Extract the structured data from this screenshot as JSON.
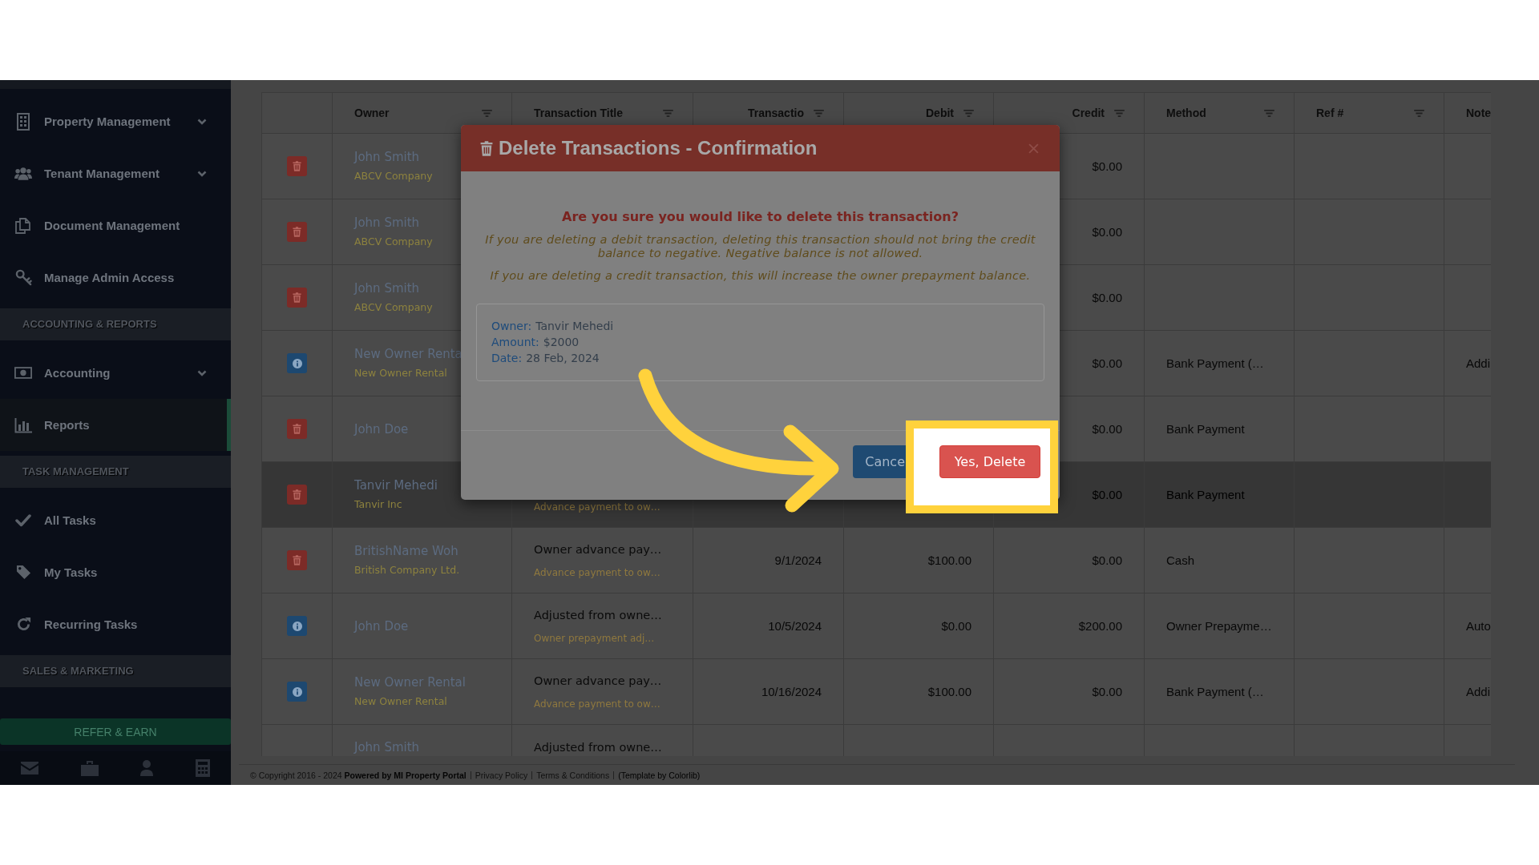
{
  "sidebar": {
    "items": [
      {
        "kind": "link",
        "label": "Property Management",
        "submenu": true,
        "selected": false
      },
      {
        "kind": "link",
        "label": "Tenant Management",
        "submenu": true,
        "selected": false
      },
      {
        "kind": "link",
        "label": "Document Management",
        "submenu": false,
        "selected": false
      },
      {
        "kind": "link",
        "label": "Manage Admin Access",
        "submenu": false,
        "selected": false
      },
      {
        "kind": "header",
        "label": "ACCOUNTING & REPORTS"
      },
      {
        "kind": "link",
        "label": "Accounting",
        "submenu": true,
        "selected": false
      },
      {
        "kind": "link",
        "label": "Reports",
        "submenu": false,
        "selected": true
      },
      {
        "kind": "header",
        "label": "TASK MANAGEMENT"
      },
      {
        "kind": "link",
        "label": "All Tasks",
        "submenu": false,
        "selected": false
      },
      {
        "kind": "link",
        "label": "My Tasks",
        "submenu": false,
        "selected": false
      },
      {
        "kind": "link",
        "label": "Recurring Tasks",
        "submenu": false,
        "selected": false
      },
      {
        "kind": "header",
        "label": "SALES & MARKETING"
      }
    ],
    "refer_button": "REFER & EARN"
  },
  "table": {
    "columns": [
      {
        "label": "Owner",
        "kind": "text",
        "filter": true
      },
      {
        "label": "Transaction Title",
        "kind": "text",
        "filter": true
      },
      {
        "label": "Transactio",
        "kind": "number",
        "filter": true
      },
      {
        "label": "Debit",
        "kind": "number",
        "filter": true
      },
      {
        "label": "Credit",
        "kind": "number",
        "filter": true
      },
      {
        "label": "Method",
        "kind": "text",
        "filter": true
      },
      {
        "label": "Ref #",
        "kind": "text",
        "filter": true
      },
      {
        "label": "Note",
        "kind": "text",
        "filter": false
      }
    ],
    "rows": [
      {
        "kind": "delete",
        "selected": false,
        "owner": "John Smith",
        "company": "ABCV Company",
        "credit": "$0.00"
      },
      {
        "kind": "delete",
        "selected": false,
        "owner": "John Smith",
        "company": "ABCV Company",
        "credit": "$0.00"
      },
      {
        "kind": "delete",
        "selected": false,
        "owner": "John Smith",
        "company": "ABCV Company",
        "credit": "$0.00"
      },
      {
        "kind": "info",
        "selected": false,
        "owner": "New Owner Renta",
        "company": "New Owner Rental",
        "credit": "$0.00",
        "method": "Bank Payment (…",
        "note": "Addi"
      },
      {
        "kind": "delete",
        "selected": false,
        "owner": "John Doe",
        "credit": "$0.00",
        "method": "Bank Payment"
      },
      {
        "kind": "delete",
        "selected": true,
        "owner": "Tanvir Mehedi",
        "company": "Tanvir Inc",
        "title_sub": "Advance payment to ow…",
        "credit": "$0.00",
        "method": "Bank Payment"
      },
      {
        "kind": "delete",
        "selected": false,
        "owner": "BritishName Woh",
        "company": "British Company Ltd.",
        "title": "Owner advance pay…",
        "title_sub": "Advance payment to ow…",
        "date": "9/1/2024",
        "debit": "$100.00",
        "credit": "$0.00",
        "method": "Cash"
      },
      {
        "kind": "info",
        "selected": false,
        "owner": "John Doe",
        "title": "Adjusted from owne…",
        "title_sub": "Owner prepayment adj…",
        "date": "10/5/2024",
        "debit": "$0.00",
        "credit": "$200.00",
        "method": "Owner Prepayme…",
        "note": "Auto"
      },
      {
        "kind": "info",
        "selected": false,
        "owner": "New Owner Rental",
        "company": "New Owner Rental",
        "title": "Owner advance pay…",
        "title_sub": "Advance payment to ow…",
        "date": "10/16/2024",
        "debit": "$100.00",
        "credit": "$0.00",
        "method": "Bank Payment (…",
        "note": "Addi"
      },
      {
        "selected": false,
        "owner": "John Smith",
        "title": "Adjusted from owne…"
      }
    ]
  },
  "footer": {
    "copyright": "© Copyright 2016 - 2024 **Powered by MI Property Portal**",
    "links": [
      "Privacy Policy",
      "Terms & Conditions"
    ],
    "credit": "(Template by Colorlib)"
  },
  "modal": {
    "title": "Delete Transactions - Confirmation",
    "question": "Are you sure you would like to delete this transaction?",
    "warnings": [
      "If you are deleting a debit transaction, deleting this transaction should not bring the credit balance to negative. Negative balance is not allowed.",
      "If you are deleting a credit transaction, this will increase the owner prepayment balance."
    ],
    "details": [
      {
        "label": "Owner:",
        "value": "Tanvir Mehedi"
      },
      {
        "label": "Amount:",
        "value": "$2000"
      },
      {
        "label": "Date:",
        "value": "28 Feb, 2024"
      }
    ],
    "buttons": [
      {
        "label": "Cance",
        "kind": "primary"
      },
      {
        "label": "Yes, Delete",
        "kind": "danger"
      }
    ]
  },
  "annotation": {
    "highlight": true,
    "arrow": true
  }
}
